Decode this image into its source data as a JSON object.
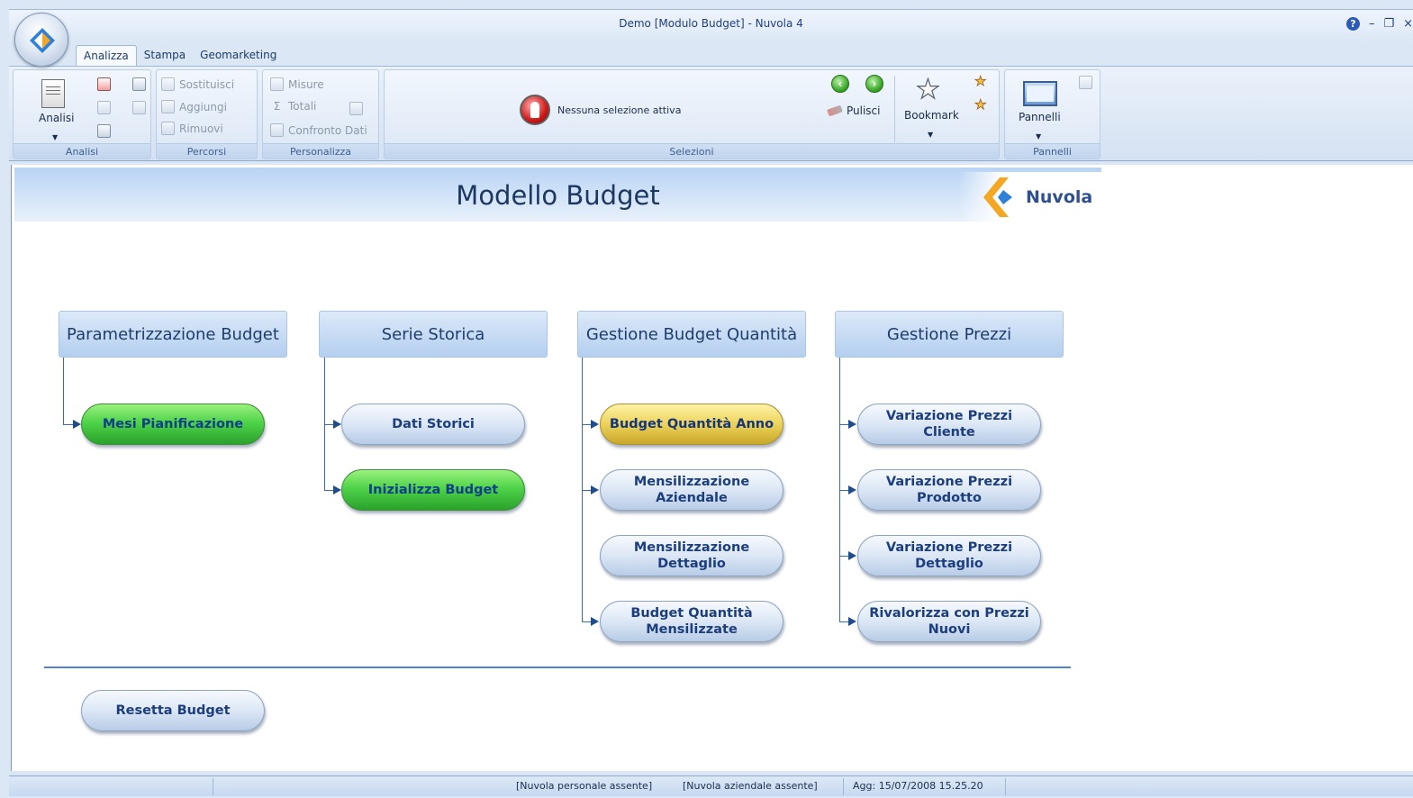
{
  "window": {
    "title": "Demo [Modulo Budget] - Nuvola 4",
    "controls": [
      "?",
      "–",
      "❐",
      "×"
    ]
  },
  "tabs": [
    {
      "label": "Analizza",
      "active": true
    },
    {
      "label": "Stampa",
      "active": false
    },
    {
      "label": "Geomarketing",
      "active": false
    }
  ],
  "ribbon": {
    "analisi": {
      "label": "Analisi",
      "group_label": "Analisi"
    },
    "percorsi": {
      "group_label": "Percorsi",
      "sostituisci": "Sostituisci",
      "aggiungi": "Aggiungi",
      "rimuovi": "Rimuovi"
    },
    "personalizza": {
      "group_label": "Personalizza",
      "misure": "Misure",
      "totali": "Totali",
      "confronto": "Confronto Dati"
    },
    "selezioni": {
      "group_label": "Selezioni",
      "status": "Nessuna selezione attiva",
      "pulisci": "Pulisci",
      "bookmark": "Bookmark"
    },
    "pannelli": {
      "label": "Pannelli",
      "group_label": "Pannelli"
    }
  },
  "main": {
    "title": "Modello Budget",
    "logo_text": "Nuvola",
    "sections": [
      {
        "header": "Parametrizzazione Budget",
        "items": [
          {
            "label": "Mesi Pianificazione",
            "color": "green"
          }
        ]
      },
      {
        "header": "Serie Storica",
        "items": [
          {
            "label": "Dati Storici",
            "color": "blue"
          },
          {
            "label": "Inizializza Budget",
            "color": "green"
          }
        ]
      },
      {
        "header": "Gestione Budget Quantità",
        "items": [
          {
            "label": "Budget Quantità Anno",
            "color": "yellow"
          },
          {
            "label": "Mensilizzazione Aziendale",
            "color": "blue"
          },
          {
            "label": "Mensilizzazione Dettaglio",
            "color": "blue"
          },
          {
            "label": "Budget Quantità Mensilizzate",
            "color": "blue"
          }
        ]
      },
      {
        "header": "Gestione Prezzi",
        "items": [
          {
            "label": "Variazione Prezzi Cliente",
            "color": "blue"
          },
          {
            "label": "Variazione Prezzi Prodotto",
            "color": "blue"
          },
          {
            "label": "Variazione Prezzi Dettaglio",
            "color": "blue"
          },
          {
            "label": "Rivalorizza con Prezzi Nuovi",
            "color": "blue"
          }
        ]
      }
    ],
    "reset_button": "Resetta Budget"
  },
  "statusbar": {
    "personale": "[Nuvola personale assente]",
    "aziendale": "[Nuvola aziendale assente]",
    "aggiornamento": "Agg: 15/07/2008 15.25.20"
  },
  "colors": {
    "accent": "#1d3763",
    "green": "#4fd34a",
    "yellow": "#ecd25a",
    "blue": "#dde8f6"
  }
}
